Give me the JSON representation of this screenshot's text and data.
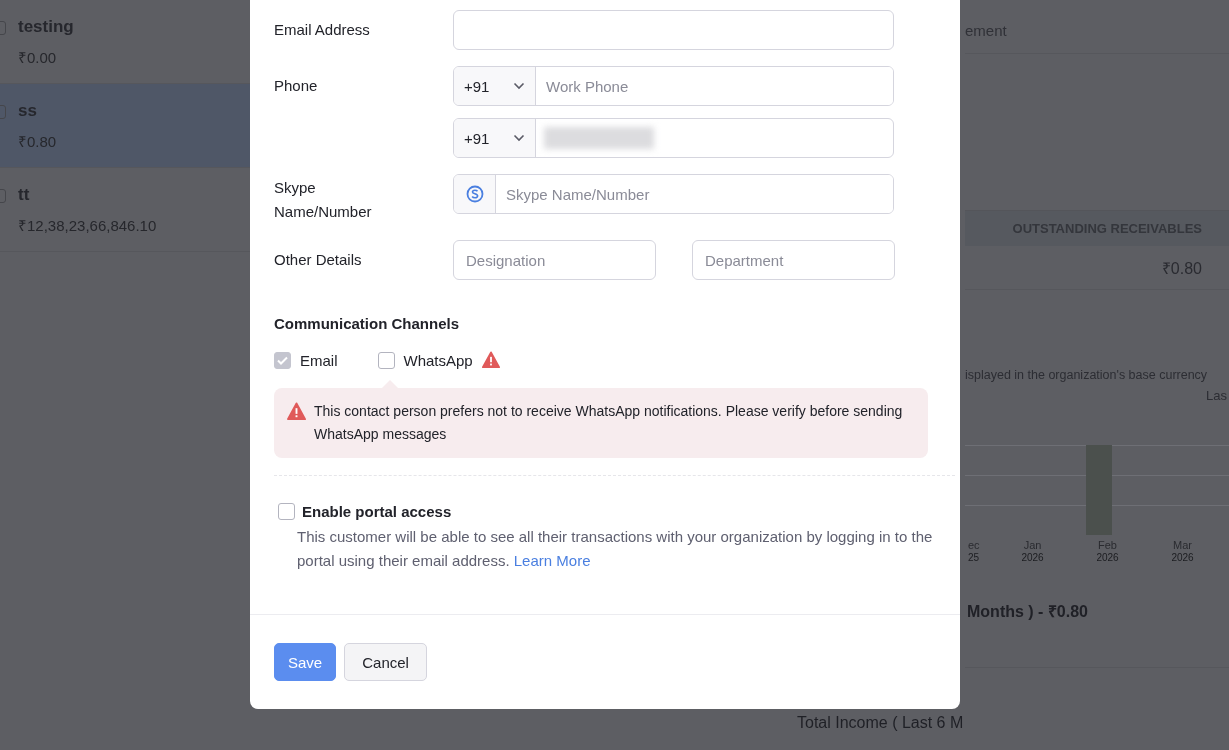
{
  "background": {
    "customers": [
      {
        "name": "testing",
        "amount": "₹0.00",
        "selected": false
      },
      {
        "name": "ss",
        "amount": "₹0.80",
        "selected": true
      },
      {
        "name": "tt",
        "amount": "₹12,38,23,66,846.10",
        "selected": false
      }
    ],
    "right_panel": {
      "tab_fragment": "ement",
      "table_header": "OUTSTANDING RECEIVABLES",
      "receivable": "₹0.80",
      "currency_note": "isplayed in the organization's base currency",
      "period_label": "Las",
      "chart_labels": [
        {
          "month": "ec",
          "year": "25"
        },
        {
          "month": "Jan",
          "year": "2026"
        },
        {
          "month": "Feb",
          "year": "2026"
        },
        {
          "month": "Mar",
          "year": "2026"
        }
      ],
      "total_summary": "Months ) - ₹0.80"
    },
    "income_label": "Total Income ( Last 6 M"
  },
  "modal": {
    "email": {
      "label": "Email Address"
    },
    "phone": {
      "label": "Phone",
      "numbers": [
        {
          "code": "+91",
          "placeholder": "Work Phone",
          "value_hidden": false
        },
        {
          "code": "+91",
          "value_hidden": true
        }
      ]
    },
    "skype": {
      "label": "Skype Name/Number",
      "placeholder": "Skype Name/Number"
    },
    "other_details": {
      "label": "Other Details",
      "fields": [
        {
          "placeholder": "Designation"
        },
        {
          "placeholder": "Department"
        }
      ]
    },
    "channels": {
      "title": "Communication Channels",
      "options": [
        {
          "label": "Email",
          "checked": true,
          "disabled": true,
          "warning": false
        },
        {
          "label": "WhatsApp",
          "checked": false,
          "disabled": false,
          "warning": true
        }
      ],
      "alert": "This contact person prefers not to receive WhatsApp notifications. Please verify before sending WhatsApp messages"
    },
    "portal": {
      "label": "Enable portal access",
      "checked": false,
      "description": "This customer will be able to see all their transactions with your organization by logging in to the portal using their email address.",
      "link": "Learn More"
    },
    "buttons": [
      {
        "label": "Save",
        "kind": "primary"
      },
      {
        "label": "Cancel",
        "kind": "secondary"
      }
    ]
  }
}
